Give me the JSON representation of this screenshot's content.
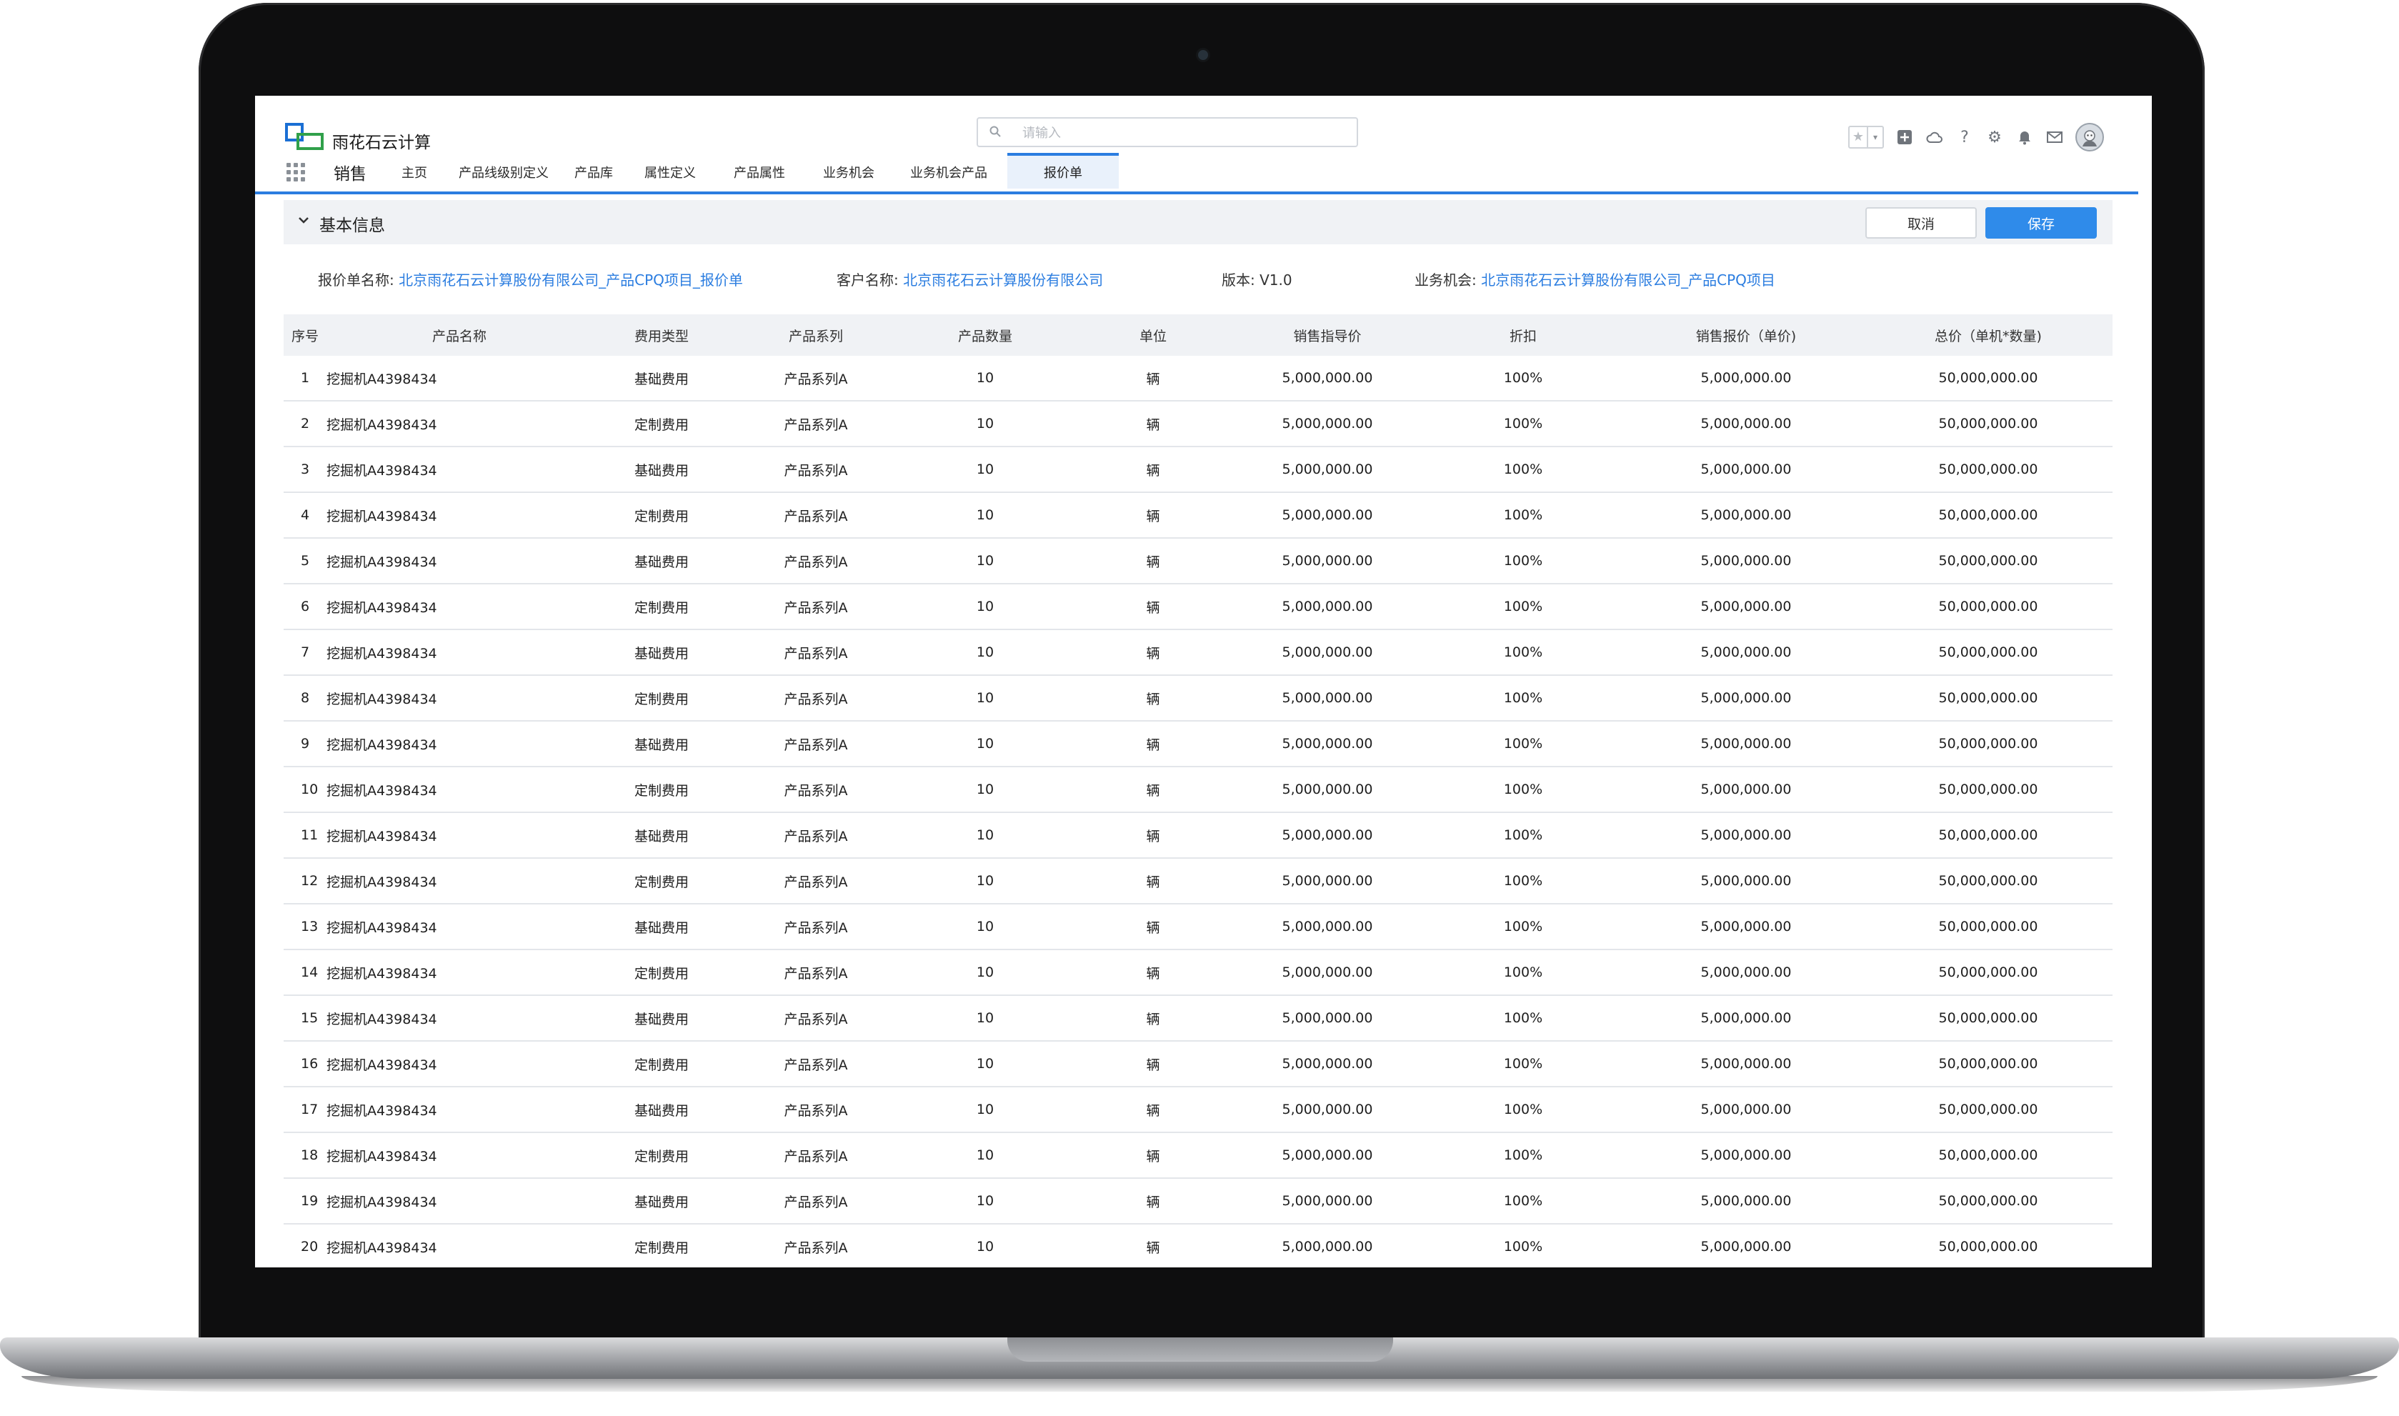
{
  "brand": {
    "name": "雨花石云计算",
    "logo_colors": [
      "#1a6fd4",
      "#30a04a"
    ]
  },
  "search": {
    "placeholder": "请输入"
  },
  "toolbar": {
    "icons": [
      "favorite-star-icon",
      "add-icon",
      "cloud-icon",
      "help-icon",
      "gear-icon",
      "bell-icon",
      "mail-icon",
      "avatar"
    ]
  },
  "nav": {
    "app_name": "销售",
    "tabs": [
      {
        "label": "主页"
      },
      {
        "label": "产品线级别定义"
      },
      {
        "label": "产品库"
      },
      {
        "label": "属性定义"
      },
      {
        "label": "产品属性"
      },
      {
        "label": "业务机会"
      },
      {
        "label": "业务机会产品"
      },
      {
        "label": "报价单"
      }
    ],
    "active_index": 7
  },
  "section": {
    "title": "基本信息",
    "cancel_label": "取消",
    "save_label": "保存"
  },
  "info": {
    "quote_name_label": "报价单名称:",
    "quote_name_value": "北京雨花石云计算股份有限公司_产品CPQ项目_报价单",
    "customer_label": "客户名称:",
    "customer_value": "北京雨花石云计算股份有限公司",
    "version_label": "版本:",
    "version_value": "V1.0",
    "opportunity_label": "业务机会:",
    "opportunity_value": "北京雨花石云计算股份有限公司_产品CPQ项目"
  },
  "table": {
    "columns": [
      "序号",
      "产品名称",
      "费用类型",
      "产品系列",
      "产品数量",
      "单位",
      "销售指导价",
      "折扣",
      "销售报价（单价)",
      "总价（单机*数量)"
    ],
    "rows": [
      [
        "1",
        "挖掘机A4398434",
        "基础费用",
        "产品系列A",
        "10",
        "辆",
        "5,000,000.00",
        "100%",
        "5,000,000.00",
        "50,000,000.00"
      ],
      [
        "2",
        "挖掘机A4398434",
        "定制费用",
        "产品系列A",
        "10",
        "辆",
        "5,000,000.00",
        "100%",
        "5,000,000.00",
        "50,000,000.00"
      ],
      [
        "3",
        "挖掘机A4398434",
        "基础费用",
        "产品系列A",
        "10",
        "辆",
        "5,000,000.00",
        "100%",
        "5,000,000.00",
        "50,000,000.00"
      ],
      [
        "4",
        "挖掘机A4398434",
        "定制费用",
        "产品系列A",
        "10",
        "辆",
        "5,000,000.00",
        "100%",
        "5,000,000.00",
        "50,000,000.00"
      ],
      [
        "5",
        "挖掘机A4398434",
        "基础费用",
        "产品系列A",
        "10",
        "辆",
        "5,000,000.00",
        "100%",
        "5,000,000.00",
        "50,000,000.00"
      ],
      [
        "6",
        "挖掘机A4398434",
        "定制费用",
        "产品系列A",
        "10",
        "辆",
        "5,000,000.00",
        "100%",
        "5,000,000.00",
        "50,000,000.00"
      ],
      [
        "7",
        "挖掘机A4398434",
        "基础费用",
        "产品系列A",
        "10",
        "辆",
        "5,000,000.00",
        "100%",
        "5,000,000.00",
        "50,000,000.00"
      ],
      [
        "8",
        "挖掘机A4398434",
        "定制费用",
        "产品系列A",
        "10",
        "辆",
        "5,000,000.00",
        "100%",
        "5,000,000.00",
        "50,000,000.00"
      ],
      [
        "9",
        "挖掘机A4398434",
        "基础费用",
        "产品系列A",
        "10",
        "辆",
        "5,000,000.00",
        "100%",
        "5,000,000.00",
        "50,000,000.00"
      ],
      [
        "10",
        "挖掘机A4398434",
        "定制费用",
        "产品系列A",
        "10",
        "辆",
        "5,000,000.00",
        "100%",
        "5,000,000.00",
        "50,000,000.00"
      ],
      [
        "11",
        "挖掘机A4398434",
        "基础费用",
        "产品系列A",
        "10",
        "辆",
        "5,000,000.00",
        "100%",
        "5,000,000.00",
        "50,000,000.00"
      ],
      [
        "12",
        "挖掘机A4398434",
        "定制费用",
        "产品系列A",
        "10",
        "辆",
        "5,000,000.00",
        "100%",
        "5,000,000.00",
        "50,000,000.00"
      ],
      [
        "13",
        "挖掘机A4398434",
        "基础费用",
        "产品系列A",
        "10",
        "辆",
        "5,000,000.00",
        "100%",
        "5,000,000.00",
        "50,000,000.00"
      ],
      [
        "14",
        "挖掘机A4398434",
        "定制费用",
        "产品系列A",
        "10",
        "辆",
        "5,000,000.00",
        "100%",
        "5,000,000.00",
        "50,000,000.00"
      ],
      [
        "15",
        "挖掘机A4398434",
        "基础费用",
        "产品系列A",
        "10",
        "辆",
        "5,000,000.00",
        "100%",
        "5,000,000.00",
        "50,000,000.00"
      ],
      [
        "16",
        "挖掘机A4398434",
        "定制费用",
        "产品系列A",
        "10",
        "辆",
        "5,000,000.00",
        "100%",
        "5,000,000.00",
        "50,000,000.00"
      ],
      [
        "17",
        "挖掘机A4398434",
        "基础费用",
        "产品系列A",
        "10",
        "辆",
        "5,000,000.00",
        "100%",
        "5,000,000.00",
        "50,000,000.00"
      ],
      [
        "18",
        "挖掘机A4398434",
        "定制费用",
        "产品系列A",
        "10",
        "辆",
        "5,000,000.00",
        "100%",
        "5,000,000.00",
        "50,000,000.00"
      ],
      [
        "19",
        "挖掘机A4398434",
        "基础费用",
        "产品系列A",
        "10",
        "辆",
        "5,000,000.00",
        "100%",
        "5,000,000.00",
        "50,000,000.00"
      ],
      [
        "20",
        "挖掘机A4398434",
        "定制费用",
        "产品系列A",
        "10",
        "辆",
        "5,000,000.00",
        "100%",
        "5,000,000.00",
        "50,000,000.00"
      ]
    ]
  },
  "colors": {
    "accent": "#2b7de0",
    "save_button": "#2f8bea",
    "header_bg": "#f0f2f5",
    "link": "#2b7de0"
  }
}
